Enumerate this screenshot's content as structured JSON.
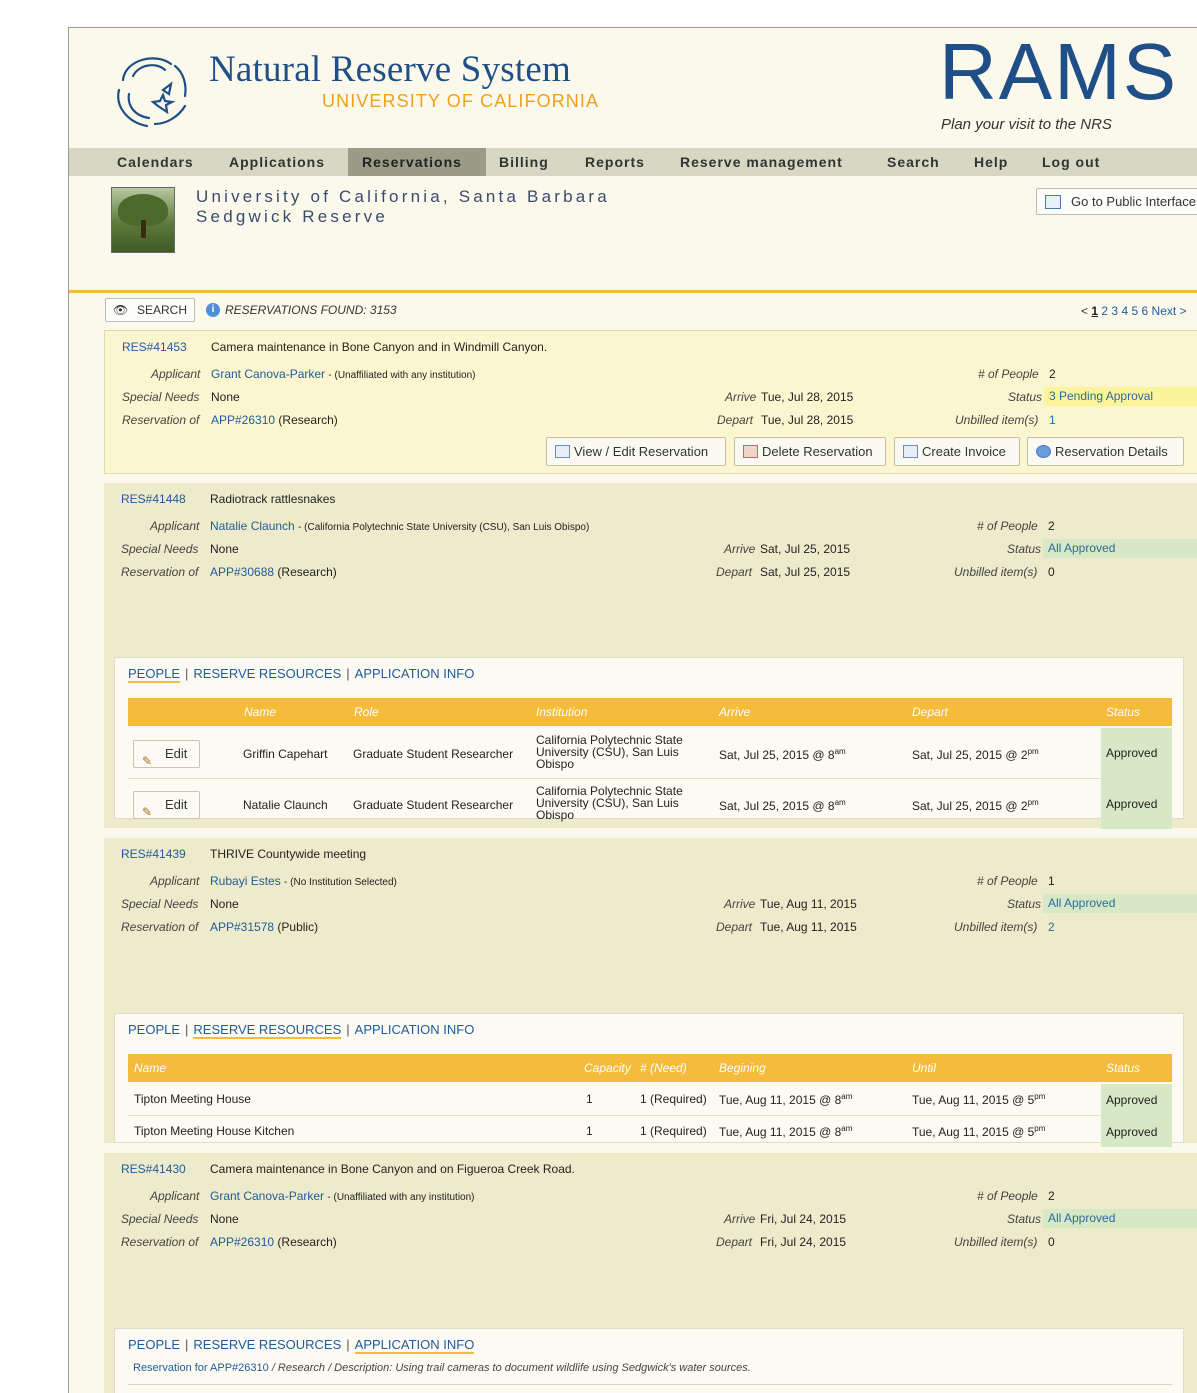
{
  "brand": {
    "title": "Natural Reserve System",
    "subtitle": "UNIVERSITY OF CALIFORNIA",
    "rams": "RAMS",
    "tagline": "Plan your visit to the NRS"
  },
  "nav": [
    {
      "label": "Calendars"
    },
    {
      "label": "Applications"
    },
    {
      "label": "Reservations",
      "active": true
    },
    {
      "label": "Billing"
    },
    {
      "label": "Reports"
    },
    {
      "label": "Reserve management"
    },
    {
      "label": "Search"
    },
    {
      "label": "Help"
    },
    {
      "label": "Log out"
    }
  ],
  "banner": {
    "university": "University of California, Santa Barbara",
    "reserve": "Sedgwick Reserve",
    "public_button": "Go to Public Interface"
  },
  "search": {
    "button": "SEARCH",
    "found": "RESERVATIONS FOUND: 3153"
  },
  "pager": {
    "prev": "<",
    "pages": [
      "1",
      "2",
      "3",
      "4",
      "5",
      "6"
    ],
    "next": "Next >"
  },
  "labels": {
    "applicant": "Applicant",
    "special_needs": "Special Needs",
    "reservation_of": "Reservation of",
    "arrive": "Arrive",
    "depart": "Depart",
    "num_people": "# of People",
    "status": "Status",
    "unbilled": "Unbilled item(s)"
  },
  "actions": {
    "view_edit": "View / Edit Reservation",
    "delete": "Delete Reservation",
    "invoice": "Create Invoice",
    "details": "Reservation Details"
  },
  "tabs": {
    "people": "PEOPLE",
    "resources": "RESERVE RESOURCES",
    "app_info": "APPLICATION INFO",
    "sep": "|"
  },
  "reservations": [
    {
      "id": "RES#41453",
      "title": "Camera maintenance in Bone Canyon and in Windmill Canyon.",
      "applicant": "Grant Canova-Parker",
      "affiliation": "- (Unaffiliated with any institution)",
      "special_needs": "None",
      "app_id": "APP#26310",
      "app_type": "(Research)",
      "arrive": "Tue, Jul 28, 2015",
      "depart": "Tue, Jul 28, 2015",
      "people": "2",
      "status": "3 Pending Approval",
      "unbilled": "1"
    },
    {
      "id": "RES#41448",
      "title": "Radiotrack rattlesnakes",
      "applicant": "Natalie Claunch",
      "affiliation": "- (California Polytechnic State University (CSU), San Luis Obispo)",
      "special_needs": "None",
      "app_id": "APP#30688",
      "app_type": "(Research)",
      "arrive": "Sat, Jul 25, 2015",
      "depart": "Sat, Jul 25, 2015",
      "people": "2",
      "status": "All Approved",
      "unbilled": "0",
      "people_table": {
        "headers": [
          "Name",
          "Role",
          "Institution",
          "Arrive",
          "Depart",
          "Status"
        ],
        "edit_label": "Edit",
        "rows": [
          {
            "name": "Griffin Capehart",
            "role": "Graduate Student Researcher",
            "institution": "California Polytechnic State University (CSU), San Luis Obispo",
            "arrive": "Sat, Jul 25, 2015 @ 8",
            "arrive_sup": "am",
            "depart": "Sat, Jul 25, 2015 @ 2",
            "depart_sup": "pm",
            "status": "Approved"
          },
          {
            "name": "Natalie Claunch",
            "role": "Graduate Student Researcher",
            "institution": "California Polytechnic State University (CSU), San Luis Obispo",
            "arrive": "Sat, Jul 25, 2015 @ 8",
            "arrive_sup": "am",
            "depart": "Sat, Jul 25, 2015 @ 2",
            "depart_sup": "pm",
            "status": "Approved"
          }
        ]
      }
    },
    {
      "id": "RES#41439",
      "title": "THRIVE Countywide meeting",
      "applicant": "Rubayi Estes",
      "affiliation": "- (No Institution Selected)",
      "special_needs": "None",
      "app_id": "APP#31578",
      "app_type": "(Public)",
      "arrive": "Tue, Aug 11, 2015",
      "depart": "Tue, Aug 11, 2015",
      "people": "1",
      "status": "All Approved",
      "unbilled": "2",
      "resources_table": {
        "headers": [
          "Name",
          "Capacity",
          "# (Need)",
          "Begining",
          "Until",
          "Status"
        ],
        "rows": [
          {
            "name": "Tipton Meeting House",
            "capacity": "1",
            "need": "1 (Required)",
            "begin": "Tue, Aug 11, 2015 @ 8",
            "begin_sup": "am",
            "until": "Tue, Aug 11, 2015 @ 5",
            "until_sup": "pm",
            "status": "Approved"
          },
          {
            "name": "Tipton Meeting House Kitchen",
            "capacity": "1",
            "need": "1 (Required)",
            "begin": "Tue, Aug 11, 2015 @ 8",
            "begin_sup": "am",
            "until": "Tue, Aug 11, 2015 @ 5",
            "until_sup": "pm",
            "status": "Approved"
          }
        ]
      }
    },
    {
      "id": "RES#41430",
      "title": "Camera maintenance in Bone Canyon and on Figueroa Creek Road.",
      "applicant": "Grant Canova-Parker",
      "affiliation": "- (Unaffiliated with any institution)",
      "special_needs": "None",
      "app_id": "APP#26310",
      "app_type": "(Research)",
      "arrive": "Fri, Jul 24, 2015",
      "depart": "Fri, Jul 24, 2015",
      "people": "2",
      "status": "All Approved",
      "unbilled": "0",
      "app_info": {
        "link": "Reservation for APP#26310",
        "text": " / Research / Description: Using trail cameras to document wildlife using Sedgwick's water sources."
      }
    }
  ]
}
